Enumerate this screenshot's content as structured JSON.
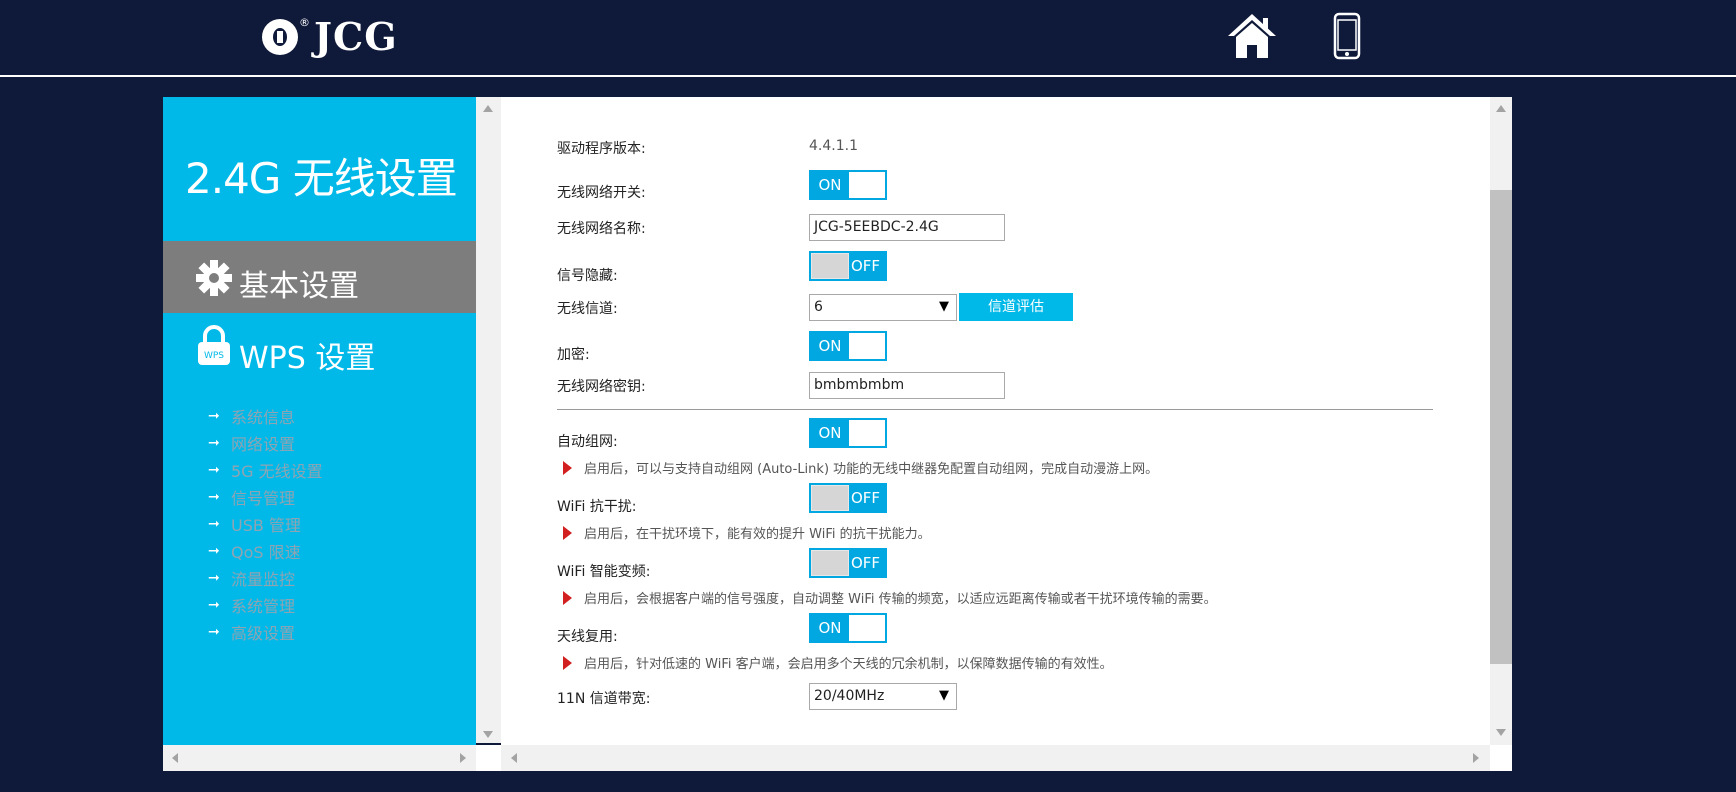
{
  "header": {
    "logo_text": "JCG",
    "logo_mark": "®",
    "home_icon": "home-icon",
    "phone_icon": "phone-icon"
  },
  "sidebar": {
    "title": "2.4G 无线设置",
    "items": [
      {
        "label": "基本设置",
        "icon": "gear-icon"
      },
      {
        "label": "WPS 设置",
        "icon": "lock-icon"
      }
    ],
    "submenu": [
      "系统信息",
      "网络设置",
      "5G 无线设置",
      "信号管理",
      "USB 管理",
      "QoS 限速",
      "流量监控",
      "系统管理",
      "高级设置"
    ]
  },
  "form": {
    "driver_version": {
      "label": "驱动程序版本:",
      "value": "4.4.1.1"
    },
    "wifi_switch": {
      "label": "无线网络开关:",
      "state": "ON"
    },
    "ssid": {
      "label": "无线网络名称:",
      "value": "JCG-5EEBDC-2.4G"
    },
    "hide_ssid": {
      "label": "信号隐藏:",
      "state": "OFF"
    },
    "channel": {
      "label": "无线信道:",
      "value": "6",
      "button": "信道评估"
    },
    "encryption": {
      "label": "加密:",
      "state": "ON"
    },
    "password": {
      "label": "无线网络密钥:",
      "value": "bmbmbmbm"
    },
    "auto_mesh": {
      "label": "自动组网:",
      "state": "ON",
      "note": "启用后，可以与支持自动组网 (Auto-Link) 功能的无线中继器免配置自动组网，完成自动漫游上网。"
    },
    "anti_interference": {
      "label": "WiFi 抗干扰:",
      "state": "OFF",
      "note": "启用后，在干扰环境下，能有效的提升 WiFi 的抗干扰能力。"
    },
    "smart_band": {
      "label": "WiFi 智能变频:",
      "state": "OFF",
      "note": "启用后，会根据客户端的信号强度，自动调整 WiFi 传输的频宽，以适应远距离传输或者干扰环境传输的需要。"
    },
    "antenna_reuse": {
      "label": "天线复用:",
      "state": "ON",
      "note": "启用后，针对低速的 WiFi 客户端，会启用多个天线的冗余机制，以保障数据传输的有效性。"
    },
    "bandwidth": {
      "label": "11N 信道带宽:",
      "value": "20/40MHz"
    }
  },
  "colors": {
    "background": "#0f1a3a",
    "sidebar": "#00b9e8",
    "active_item": "#7d7d7d",
    "toggle": "#00a7e1",
    "note_flag": "#d21f1f"
  }
}
